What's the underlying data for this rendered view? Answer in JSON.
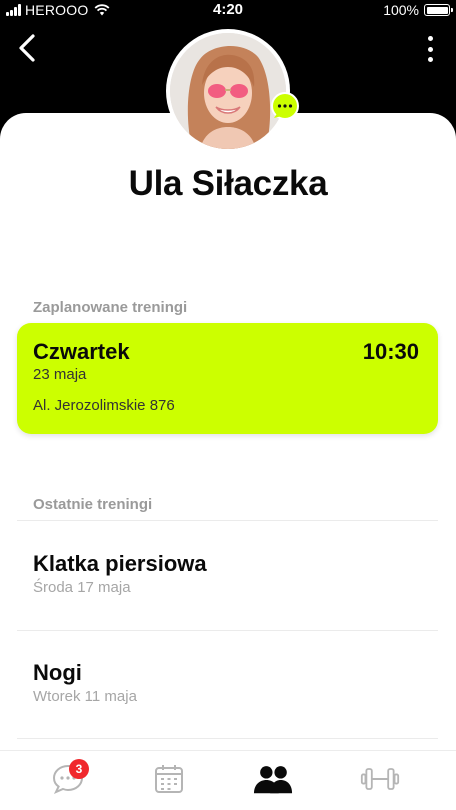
{
  "status_bar": {
    "carrier": "HEROOO",
    "time": "4:20",
    "battery": "100%"
  },
  "header": {
    "back_icon": "chevron-left-icon",
    "menu_icon": "more-vertical-icon"
  },
  "profile": {
    "name": "Ula Siłaczka",
    "chat_badge_icon": "chat-bubble-icon"
  },
  "planned": {
    "section_title": "Zaplanowane treningi",
    "card": {
      "day": "Czwartek",
      "time": "10:30",
      "date": "23 maja",
      "address": "Al. Jerozolimskie 876"
    }
  },
  "recent": {
    "section_title": "Ostatnie treningi",
    "items": [
      {
        "title": "Klatka piersiowa",
        "date": "Środa 17 maja"
      },
      {
        "title": "Nogi",
        "date": "Wtorek 11 maja"
      }
    ]
  },
  "tab_bar": {
    "messages_badge": "3",
    "tabs": [
      "chat-icon",
      "calendar-icon",
      "people-icon",
      "dumbbell-icon"
    ]
  },
  "colors": {
    "accent": "#ccff00",
    "badge": "#f0282d",
    "header_bg": "#000000"
  }
}
